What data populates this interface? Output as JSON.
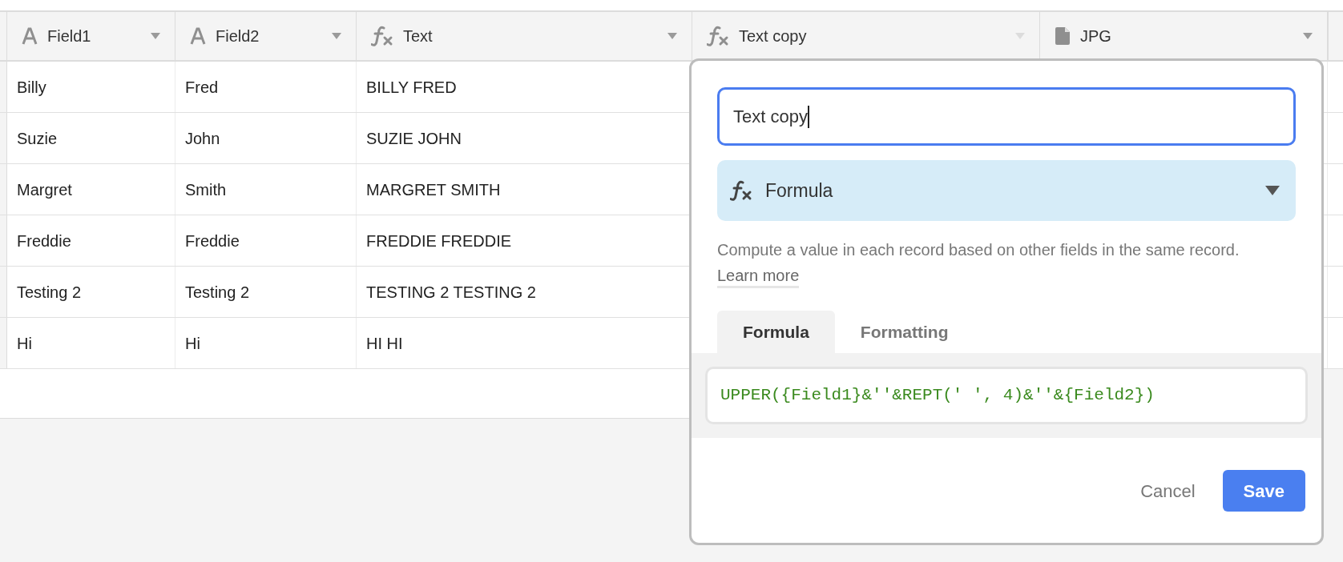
{
  "table": {
    "columns": [
      {
        "label": "Field1",
        "kind": "text",
        "editing": false
      },
      {
        "label": "Field2",
        "kind": "text",
        "editing": false
      },
      {
        "label": "Text",
        "kind": "formula",
        "editing": false
      },
      {
        "label": "Text copy",
        "kind": "formula",
        "editing": true
      },
      {
        "label": "JPG",
        "kind": "attachment",
        "editing": false
      }
    ],
    "rows": [
      [
        "Billy",
        "Fred",
        "BILLY FRED"
      ],
      [
        "Suzie",
        "John",
        "SUZIE JOHN"
      ],
      [
        "Margret",
        "Smith",
        "MARGRET SMITH"
      ],
      [
        "Freddie",
        "Freddie",
        "FREDDIE FREDDIE"
      ],
      [
        "Testing 2",
        "Testing 2",
        "TESTING 2 TESTING 2"
      ],
      [
        "Hi",
        "Hi",
        "HI HI"
      ]
    ]
  },
  "field_editor": {
    "name_value": "Text copy",
    "type": {
      "label": "Formula",
      "kind": "formula"
    },
    "description": "Compute a value in each record based on other fields in the same record.",
    "learn_more": "Learn more",
    "tabs": [
      {
        "label": "Formula",
        "selected": true
      },
      {
        "label": "Formatting",
        "selected": false
      }
    ],
    "formula": "UPPER({Field1}&''&REPT(' ', 4)&''&{Field2})",
    "buttons": [
      {
        "label": "Cancel",
        "kind": "secondary"
      },
      {
        "label": "Save",
        "kind": "primary"
      }
    ]
  }
}
